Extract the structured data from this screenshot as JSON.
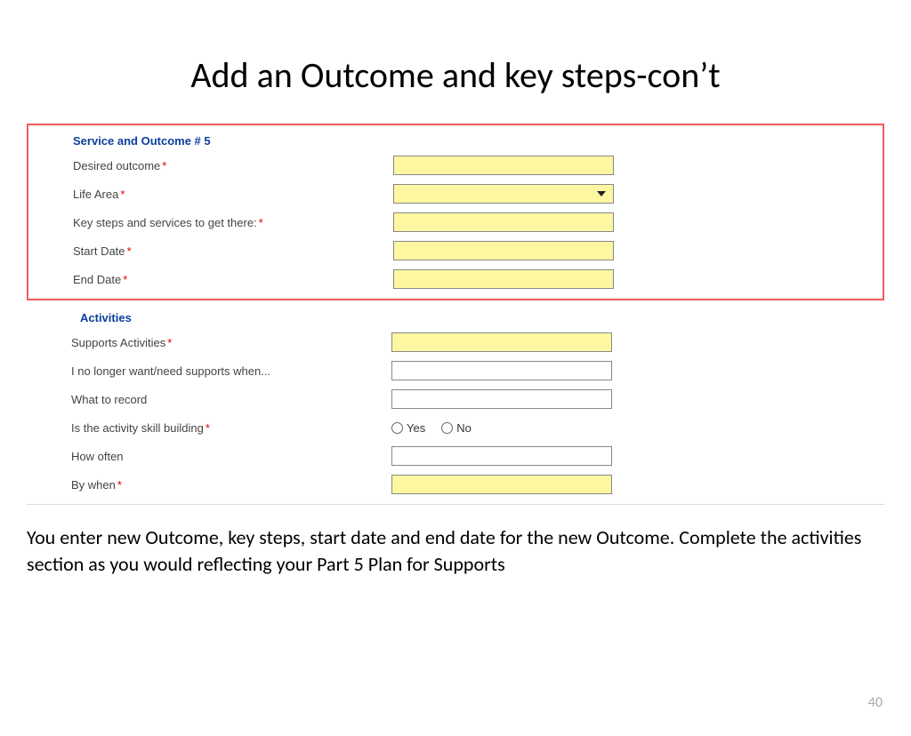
{
  "title": "Add an Outcome and key steps-con’t",
  "highlightSection": {
    "heading": "Service and Outcome # 5",
    "fields": {
      "desired_outcome": {
        "label": "Desired outcome",
        "required": true
      },
      "life_area": {
        "label": "Life Area",
        "required": true
      },
      "key_steps": {
        "label": "Key steps and services to get there:",
        "required": true
      },
      "start_date": {
        "label": "Start Date",
        "required": true
      },
      "end_date": {
        "label": "End Date",
        "required": true
      }
    }
  },
  "activitiesSection": {
    "heading": "Activities",
    "fields": {
      "supports": {
        "label": "Supports Activities",
        "required": true
      },
      "no_longer": {
        "label": "I no longer want/need supports when...",
        "required": false
      },
      "what_record": {
        "label": "What to record",
        "required": false
      },
      "skill_build": {
        "label": "Is the activity skill building",
        "required": true,
        "options": {
          "yes": "Yes",
          "no": "No"
        }
      },
      "how_often": {
        "label": "How often",
        "required": false
      },
      "by_when": {
        "label": "By when",
        "required": true
      }
    }
  },
  "caption": "You enter new Outcome, key steps, start date and end date for the new Outcome. Complete the activities section as you would reflecting your Part 5 Plan for Supports",
  "page_number": "40"
}
